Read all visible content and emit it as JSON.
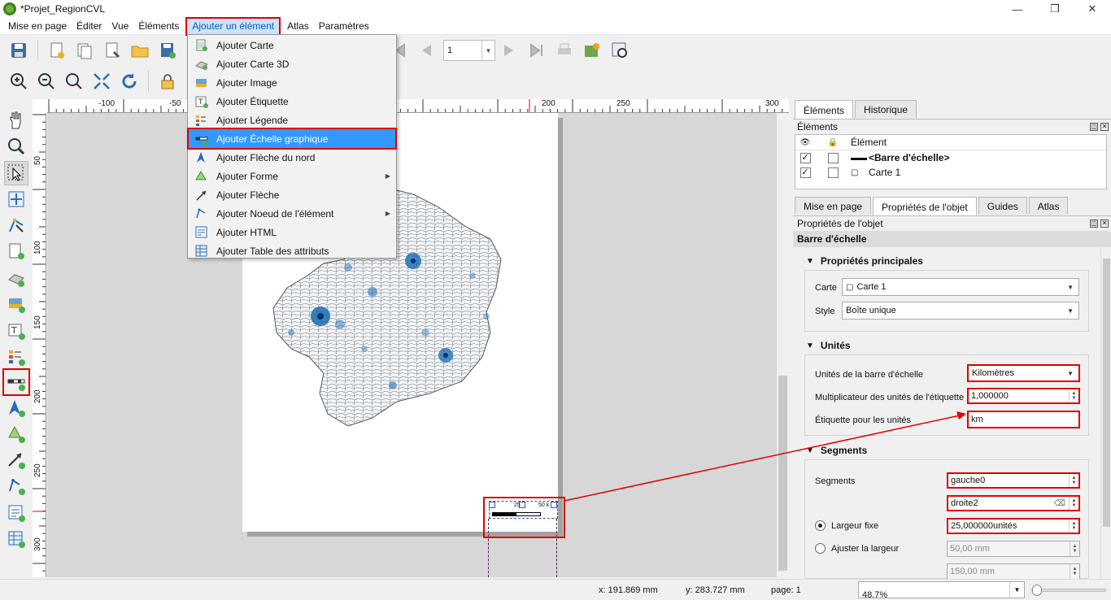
{
  "window": {
    "title": "*Projet_RegionCVL",
    "minimize": "—",
    "restore": "❐",
    "close": "✕"
  },
  "menubar": [
    "Mise en page",
    "Éditer",
    "Vue",
    "Éléments",
    "Ajouter un élément",
    "Atlas",
    "Paramètres"
  ],
  "toolbar": {
    "page_value": "1"
  },
  "dropdown": {
    "items": [
      {
        "label": "Ajouter Carte",
        "icon": "add-map-icon"
      },
      {
        "label": "Ajouter Carte 3D",
        "icon": "add-3d-map-icon"
      },
      {
        "label": "Ajouter Image",
        "icon": "add-picture-icon"
      },
      {
        "label": "Ajouter Étiquette",
        "icon": "add-label-icon"
      },
      {
        "label": "Ajouter Légende",
        "icon": "add-legend-icon"
      },
      {
        "label": "Ajouter Échelle graphique",
        "icon": "add-scalebar-icon",
        "active": true
      },
      {
        "label": "Ajouter Flèche du nord",
        "icon": "add-north-arrow-icon"
      },
      {
        "label": "Ajouter Forme",
        "icon": "add-shape-icon",
        "submenu": true
      },
      {
        "label": "Ajouter Flèche",
        "icon": "add-arrow-icon"
      },
      {
        "label": "Ajouter Noeud de l'élément",
        "icon": "add-node-item-icon",
        "submenu": true
      },
      {
        "label": "Ajouter HTML",
        "icon": "add-html-icon"
      },
      {
        "label": "Ajouter Table des attributs",
        "icon": "add-attribute-table-icon"
      }
    ]
  },
  "rulers": {
    "h": [
      {
        "v": "-100"
      },
      {
        "v": "-50"
      },
      {
        "v": "200"
      },
      {
        "v": "250"
      },
      {
        "v": "300"
      }
    ],
    "v": [
      {
        "v": "50"
      },
      {
        "v": "100"
      },
      {
        "v": "150"
      },
      {
        "v": "200"
      },
      {
        "v": "250"
      },
      {
        "v": "300"
      }
    ]
  },
  "canvas_scalebar": {
    "label_mid": "25",
    "label_end": "50 k"
  },
  "right_panel": {
    "top_tabs": [
      "Éléments",
      "Historique"
    ],
    "items_title": "Éléments",
    "items_header": "Élément",
    "items": [
      {
        "name": "<Barre d'échelle>",
        "visible": true,
        "bold": true
      },
      {
        "name": "Carte 1",
        "visible": true,
        "bold": false
      }
    ],
    "bottom_tabs": [
      "Mise en page",
      "Propriétés de l'objet",
      "Guides",
      "Atlas"
    ],
    "props_title": "Propriétés de l'objet",
    "props_header": "Barre d'échelle",
    "main": {
      "title": "Propriétés principales",
      "carte_label": "Carte",
      "carte_value": "Carte 1",
      "style_label": "Style",
      "style_value": "Boîte unique"
    },
    "units": {
      "title": "Unités",
      "unit_label": "Unités de la barre d'échelle",
      "unit_value": "Kilomètres",
      "mult_label": "Multiplicateur des unités de l'étiquette",
      "mult_value": "1,000000",
      "label_label": "Étiquette pour les unités",
      "label_value": "km"
    },
    "segments": {
      "title": "Segments",
      "seg_label": "Segments",
      "left_value": "gauche0",
      "right_value": "droite2",
      "fixed_label": "Largeur fixe",
      "fixed_value": "25,000000unités",
      "fit_label": "Ajuster la largeur",
      "min_value": "50,00 mm",
      "max_value": "150,00 mm"
    }
  },
  "statusbar": {
    "x": "x: 191.869 mm",
    "y": "y: 283.727 mm",
    "page": "page: 1",
    "zoom": "48.7%"
  },
  "colors": {
    "highlight": "#e00000",
    "menu_active": "#3399ff",
    "map_fill": "#2171b5"
  }
}
